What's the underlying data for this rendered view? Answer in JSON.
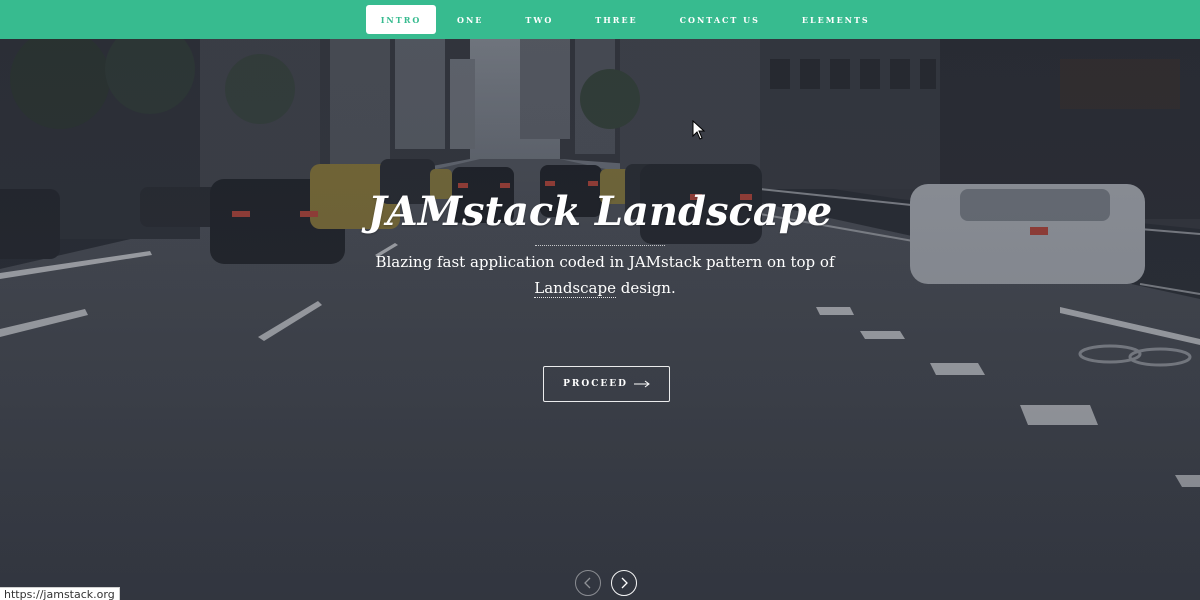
{
  "nav": {
    "items": [
      {
        "label": "INTRO",
        "active": true
      },
      {
        "label": "ONE",
        "active": false
      },
      {
        "label": "TWO",
        "active": false
      },
      {
        "label": "THREE",
        "active": false
      },
      {
        "label": "CONTACT US",
        "active": false
      },
      {
        "label": "ELEMENTS",
        "active": false
      }
    ],
    "background_color": "#37bb8f"
  },
  "hero": {
    "title": "JAMstack Landscape",
    "subtitle_before": "Blazing fast application coded in JAMstack pattern on top of",
    "subtitle_link": "Landscape",
    "subtitle_after": " design.",
    "proceed_label": "PROCEED",
    "proceed_icon": "arrow-right-icon",
    "prev_icon": "chevron-left-icon",
    "next_icon": "chevron-right-icon"
  },
  "status_bar": {
    "url": "https://jamstack.org"
  }
}
